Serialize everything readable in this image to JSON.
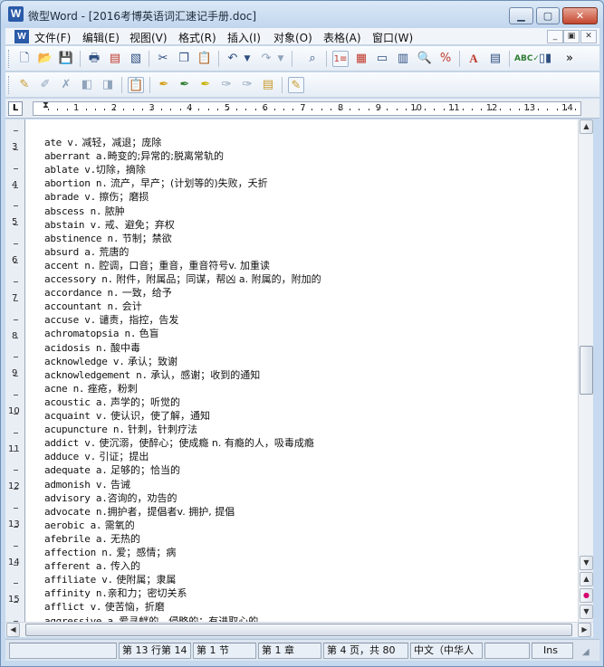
{
  "window": {
    "app_icon": "W",
    "title": "微型Word - [2016考博英语词汇速记手册.doc]",
    "minimize": "▁",
    "maximize": "▢",
    "close": "✕"
  },
  "menu": {
    "items": [
      "文件(F)",
      "编辑(E)",
      "视图(V)",
      "格式(R)",
      "插入(I)",
      "对象(O)",
      "表格(A)",
      "窗口(W)"
    ],
    "mdi_minimize": "_",
    "mdi_restore": "▣",
    "mdi_close": "✕"
  },
  "toolbar1": {
    "icons": [
      "new-document-icon",
      "open-folder-icon",
      "save-icon",
      "print-icon",
      "print-preview-icon",
      "image-icon",
      "cut-icon",
      "copy-icon",
      "paste-icon",
      "undo-icon",
      "undo-dropdown-icon",
      "redo-icon",
      "redo-dropdown-icon",
      "find-icon",
      "numbered-list-icon",
      "insert-table-icon",
      "page-view-icon",
      "columns-icon",
      "zoom-icon",
      "zoom-percent-icon",
      "font-color-icon",
      "page-setup-icon",
      "spellcheck-icon",
      "chart-icon",
      "more-icon"
    ],
    "overflow": "»"
  },
  "toolbar2": {
    "icons": [
      "bookmark-icon",
      "edit-note-icon",
      "delete-note-icon",
      "prev-note-icon",
      "next-note-icon",
      "clipboard-active-icon",
      "highlighter-icon",
      "pen-green-icon",
      "pen-yellow-icon",
      "pen-gray-icon",
      "eraser-icon",
      "notepad-icon",
      "note-active-icon"
    ]
  },
  "ruler": {
    "corner": "L",
    "numbers": [
      "1",
      "2",
      "3",
      "4",
      "5",
      "6",
      "7",
      "8",
      "9",
      "10",
      "11",
      "12",
      "13",
      "14"
    ],
    "vertical_numbers": [
      "3",
      "4",
      "5",
      "6",
      "7",
      "8",
      "9",
      "10",
      "11",
      "12",
      "13",
      "14",
      "15"
    ]
  },
  "document": {
    "lines": [
      {
        "en": "ate v.",
        "cn": " 减轻，减退；庞除"
      },
      {
        "en": "aberrant a.",
        "cn": "畸变的;异常的;脱离常轨的"
      },
      {
        "en": "ablate v.",
        "cn": "切除，摘除"
      },
      {
        "en": "abortion n.",
        "cn": " 流产，早产；(计划等的)失败，夭折"
      },
      {
        "en": "abrade v.",
        "cn": " 擦伤；磨损"
      },
      {
        "en": "abscess n.",
        "cn": " 脓肿"
      },
      {
        "en": "abstain v.",
        "cn": " 戒、避免；弃权"
      },
      {
        "en": "abstinence n.",
        "cn": " 节制；禁欲"
      },
      {
        "en": "absurd a.",
        "cn": " 荒唐的"
      },
      {
        "en": "accent n.",
        "cn": " 腔调，口音；重音，重音符号v. 加重读"
      },
      {
        "en": "accessory n.",
        "cn": " 附件，附属品；同谋，帮凶 a. 附属的，附加的"
      },
      {
        "en": "accordance n.",
        "cn": " 一致，给予"
      },
      {
        "en": "accountant n.",
        "cn": " 会计"
      },
      {
        "en": "accuse v.",
        "cn": " 谴责，指控，告发"
      },
      {
        "en": "achromatopsia n.",
        "cn": " 色盲"
      },
      {
        "en": "acidosis n.",
        "cn": " 酸中毒"
      },
      {
        "en": "acknowledge v.",
        "cn": " 承认；致谢"
      },
      {
        "en": "acknowledgement n.",
        "cn": " 承认，感谢；收到的通知"
      },
      {
        "en": "acne n.",
        "cn": " 痤疮，粉刺"
      },
      {
        "en": "acoustic a.",
        "cn": " 声学的；听觉的"
      },
      {
        "en": "acquaint v.",
        "cn": " 使认识，使了解，通知"
      },
      {
        "en": "acupuncture n.",
        "cn": " 针刺，针刺疗法"
      },
      {
        "en": "addict v.",
        "cn": " 使沉溺，使醉心；使成瘾 n. 有瘾的人，吸毒成瘾"
      },
      {
        "en": "adduce v.",
        "cn": " 引证；提出"
      },
      {
        "en": "adequate a.",
        "cn": " 足够的；恰当的"
      },
      {
        "en": "admonish v.",
        "cn": " 告诫"
      },
      {
        "en": "advisory a.",
        "cn": "咨询的，劝告的"
      },
      {
        "en": "advocate n.",
        "cn": "拥护者，提倡者v. 拥护, 提倡"
      },
      {
        "en": "aerobic a.",
        "cn": " 需氧的"
      },
      {
        "en": "afebrile a.",
        "cn": " 无热的"
      },
      {
        "en": "affection n.",
        "cn": " 爱；感情；病"
      },
      {
        "en": "afferent a.",
        "cn": " 传入的"
      },
      {
        "en": "affiliate v.",
        "cn": " 使附属；隶属"
      },
      {
        "en": "affinity n.",
        "cn": "亲和力；密切关系"
      },
      {
        "en": "afflict v.",
        "cn": " 使苦恼，折磨"
      },
      {
        "en": "aggressive a.",
        "cn": "爱寻衅的，侵略的；有进取心的"
      }
    ]
  },
  "scrollbars": {
    "up": "▲",
    "down": "▼",
    "prev_page": "▲",
    "select_browse": "●",
    "next_page": "▼",
    "left": "◀",
    "right": "▶"
  },
  "statusbar": {
    "row": "第 13 行第 14",
    "section": "第 1 节",
    "chapter": "第 1 章",
    "page": "第 4 页，共 80",
    "language": "中文（中华人",
    "mode": "Ins"
  },
  "colors": {
    "close_button": "#c4462e",
    "select_browse": "#d6006f"
  }
}
